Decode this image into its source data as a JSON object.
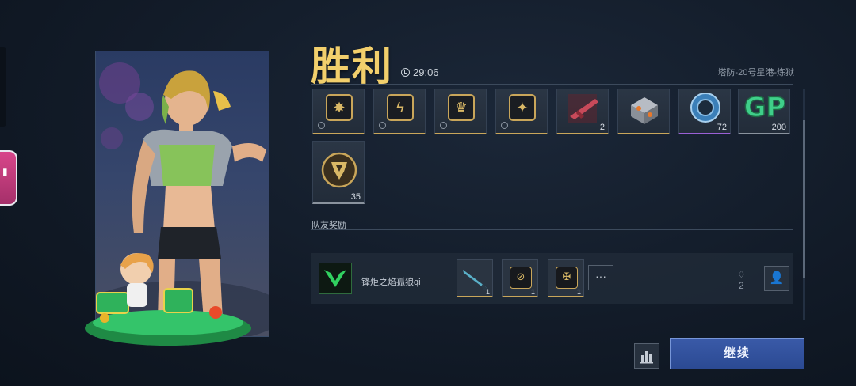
{
  "header": {
    "title": "胜利",
    "timer": "29:06",
    "map_name": "塔防-20号星港-炼狱"
  },
  "rewards": [
    {
      "icon": "spider-emblem-icon",
      "count": ""
    },
    {
      "icon": "lightning-emblem-icon",
      "count": ""
    },
    {
      "icon": "crown-emblem-icon",
      "count": ""
    },
    {
      "icon": "beetle-emblem-icon",
      "count": ""
    },
    {
      "icon": "gun-blueprint-icon",
      "count": "2"
    },
    {
      "icon": "supply-crate-icon",
      "count": ""
    },
    {
      "icon": "blue-token-icon",
      "count": "72"
    },
    {
      "icon": "gp-currency-icon",
      "count": "200"
    },
    {
      "icon": "shield-badge-icon",
      "count": "35"
    }
  ],
  "teammates_section": {
    "label": "队友奖励"
  },
  "teammate": {
    "name": "锋炬之焰孤狼qi",
    "avatar_icon": "green-wolf-avatar-icon",
    "items": [
      {
        "icon": "knife-icon",
        "count": "1"
      },
      {
        "icon": "slash-emblem-icon",
        "count": "1"
      },
      {
        "icon": "cross-emblem-icon",
        "count": "1"
      }
    ],
    "more_label": "···",
    "likes": "2"
  },
  "footer": {
    "continue_label": "继续"
  },
  "colors": {
    "title_gold": "#f2cf6c",
    "rarity_gold": "#c9a65a",
    "rarity_purple": "#9a60d6",
    "continue_blue": "#2b4a93"
  }
}
